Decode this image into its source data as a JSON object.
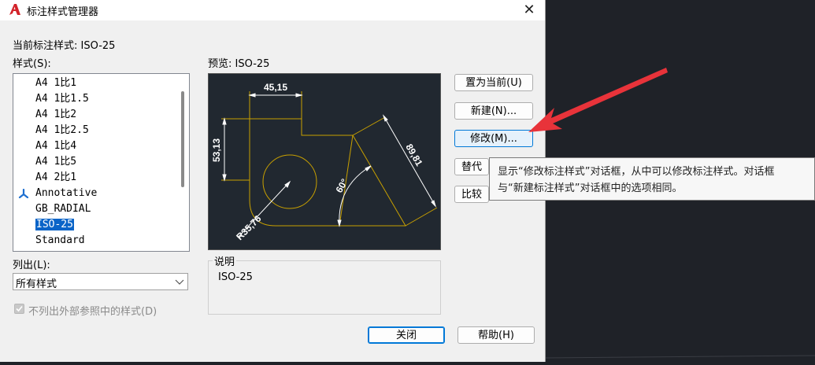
{
  "window": {
    "title": "标注样式管理器",
    "close_glyph": "✕"
  },
  "current_style": {
    "label": "当前标注样式: ISO-25"
  },
  "styles": {
    "label": "样式(S):",
    "items": [
      "A4 1比1",
      "A4 1比1.5",
      "A4 1比2",
      "A4 1比2.5",
      "A4 1比4",
      "A4 1比5",
      "A4 2比1",
      "Annotative",
      "GB_RADIAL",
      "ISO-25",
      "Standard"
    ],
    "selected": "ISO-25"
  },
  "preview": {
    "label": "预览: ISO-25",
    "dim_top": "45,15",
    "dim_left": "53,13",
    "dim_right": "89,81",
    "dim_angle": "60°",
    "dim_radius": "R35,76"
  },
  "description": {
    "label": "说明",
    "text": "ISO-25"
  },
  "list_filter": {
    "label": "列出(L):",
    "value": "所有样式"
  },
  "xref_checkbox": {
    "label": "不列出外部参照中的样式(D)",
    "checked": true,
    "enabled": false
  },
  "buttons": {
    "set_current": "置为当前(U)",
    "new": "新建(N)...",
    "modify": "修改(M)...",
    "override": "替代",
    "compare": "比较",
    "close": "关闭",
    "help": "帮助(H)"
  },
  "tooltip": {
    "line1": "显示“修改标注样式”对话框，从中可以修改标注样式。对话框",
    "line2": "与“新建标注样式”对话框中的选项相同。"
  },
  "colors": {
    "accent": "#0078d7",
    "selection": "#0a64c8",
    "preview_bg": "#212830",
    "dimension": "#c8a000",
    "arrow": "#e8333a"
  },
  "icons": [
    "autocad-logo-icon",
    "close-icon",
    "annotative-icon",
    "chevron-down-icon",
    "red-arrow-annotation"
  ]
}
